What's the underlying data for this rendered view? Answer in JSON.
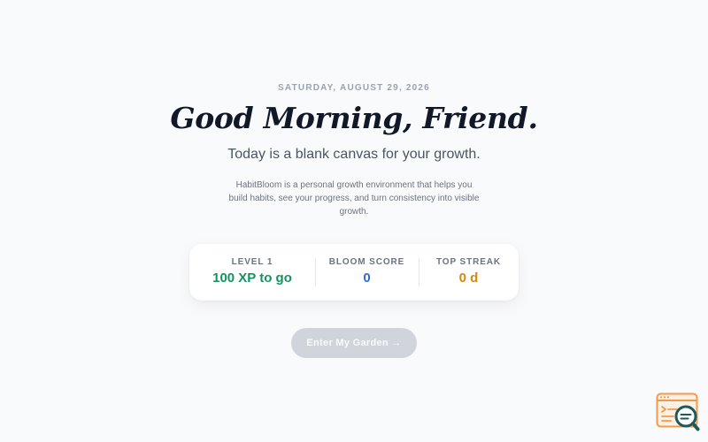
{
  "header": {
    "date": "SATURDAY, AUGUST 29, 2026",
    "greeting": "Good Morning, Friend.",
    "subtitle": "Today is a blank canvas for your growth.",
    "description": "HabitBloom is a personal growth environment that helps you build habits, see your progress, and turn consistency into visible growth."
  },
  "stats": [
    {
      "label": "LEVEL 1",
      "value": "100 XP to go",
      "color": "#15935f"
    },
    {
      "label": "BLOOM SCORE",
      "value": "0",
      "color": "#2f6bd6"
    },
    {
      "label": "TOP STREAK",
      "value": "0 d",
      "color": "#d18a0b"
    }
  ],
  "cta": {
    "label": "Enter My Garden →",
    "background": "#d1d5db"
  },
  "floating_widget": {
    "icon": "feedback-search-icon",
    "colors": {
      "window": "#f2994a",
      "magnifier": "#1e5a5a"
    }
  }
}
